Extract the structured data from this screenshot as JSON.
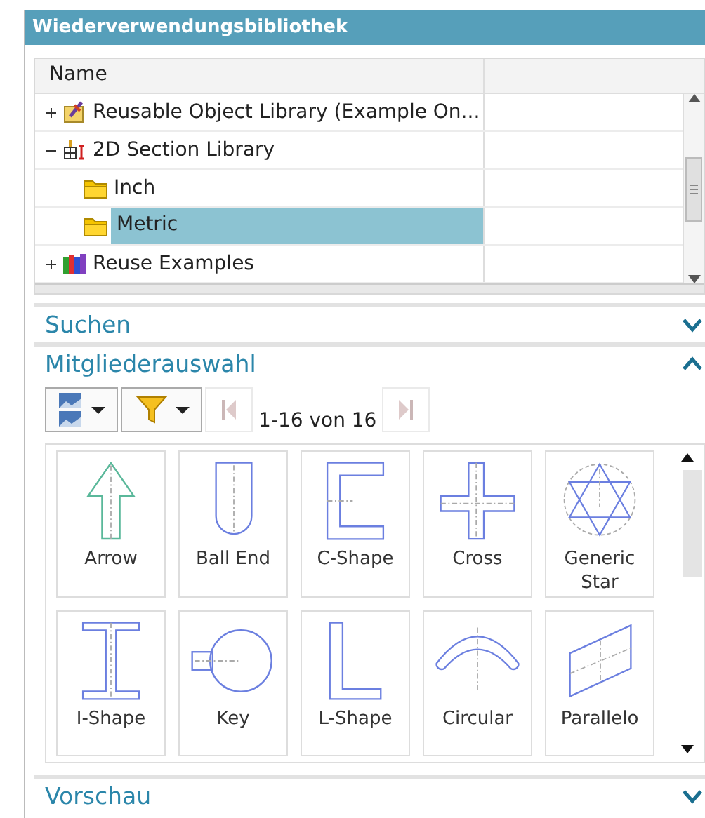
{
  "window": {
    "title": "Wiederverwendungsbibliothek"
  },
  "tree": {
    "columns": [
      "Name"
    ],
    "items": [
      {
        "label": "Reusable Object Library (Example On...",
        "kind": "library",
        "expanded": false,
        "selected": false
      },
      {
        "label": "2D Section Library",
        "kind": "section",
        "expanded": true,
        "selected": false,
        "children": [
          {
            "label": "Inch",
            "kind": "folder",
            "selected": false
          },
          {
            "label": "Metric",
            "kind": "folder",
            "selected": true
          }
        ]
      },
      {
        "label": "Reuse Examples",
        "kind": "books",
        "expanded": false,
        "selected": false
      }
    ]
  },
  "sections": [
    {
      "title": "Suchen",
      "expanded": false
    },
    {
      "title": "Mitgliederauswahl",
      "expanded": true
    }
  ],
  "member_toolbar": {
    "page_info": "1-16 von 16",
    "first_disabled": true,
    "last_disabled": true
  },
  "members": [
    {
      "label": "Arrow",
      "kind": "arrow"
    },
    {
      "label": "Ball End",
      "kind": "ballend"
    },
    {
      "label": "C-Shape",
      "kind": "cshape"
    },
    {
      "label": "Cross",
      "kind": "cross"
    },
    {
      "label": "Generic Star",
      "kind": "star"
    },
    {
      "label": "I-Shape",
      "kind": "ishape"
    },
    {
      "label": "Key",
      "kind": "key"
    },
    {
      "label": "L-Shape",
      "kind": "lshape"
    },
    {
      "label": "Circular",
      "kind": "circular"
    },
    {
      "label": "Parallelo",
      "kind": "parallelogram"
    }
  ],
  "preview": {
    "title": "Vorschau",
    "expanded": false
  }
}
